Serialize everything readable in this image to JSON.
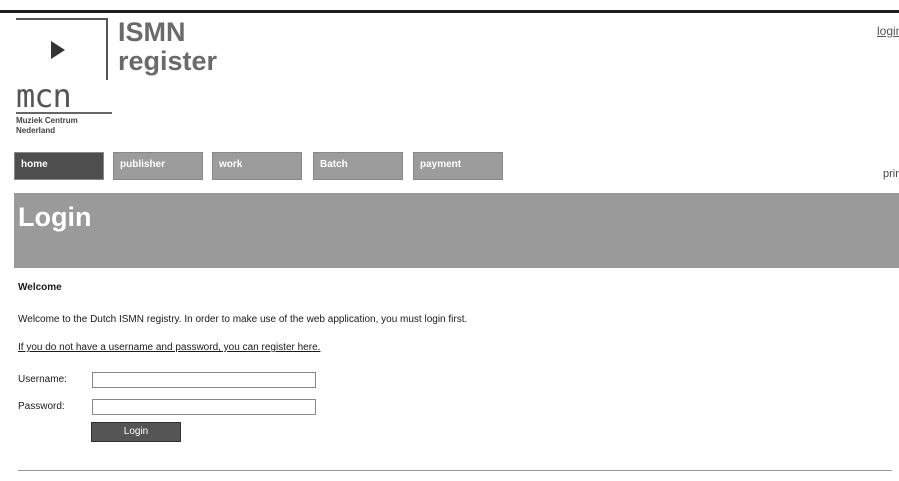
{
  "header": {
    "logo_org_line1": "Muziek Centrum",
    "logo_org_line2": "Nederland",
    "logo_mark": "mcn",
    "app_title_line1": "ISMN",
    "app_title_line2": "register",
    "login_link": "login",
    "print_link": "print"
  },
  "nav": {
    "items": [
      {
        "label": "home",
        "active": true
      },
      {
        "label": "publisher",
        "active": false
      },
      {
        "label": "work",
        "active": false
      },
      {
        "label": "Batch",
        "active": false
      },
      {
        "label": "payment",
        "active": false
      }
    ]
  },
  "page": {
    "title": "Login"
  },
  "welcome": {
    "heading": "Welcome",
    "text": "Welcome to the Dutch ISMN registry. In order to make use of the web application, you must login first.",
    "register_link": "If you do not have a username and password, you can register here."
  },
  "form": {
    "username_label": "Username:",
    "username_value": "",
    "password_label": "Password:",
    "password_value": "",
    "submit_label": "Login"
  },
  "colors": {
    "nav_active": "#4e4e4e",
    "nav_inactive": "#9c9c9c",
    "banner": "#9a9a9a"
  }
}
